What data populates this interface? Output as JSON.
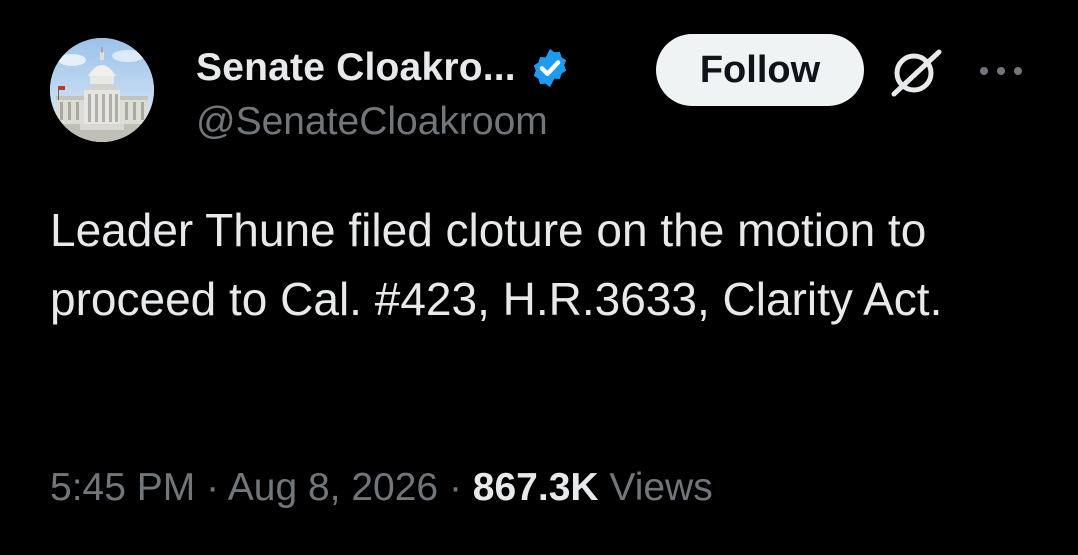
{
  "author": {
    "display_name": "Senate Cloakro...",
    "handle": "@SenateCloakroom",
    "verified": true
  },
  "actions": {
    "follow_label": "Follow",
    "grok_icon": "grok-icon",
    "more_icon": "more-icon"
  },
  "tweet": {
    "text": "Leader Thune filed cloture on the motion to proceed to Cal. #423, H.R.3633, Clarity Act.",
    "time": "5:45 PM",
    "separator": " · ",
    "date": "Aug 8, 2026",
    "views_count": "867.3K",
    "views_label": " Views"
  },
  "colors": {
    "background": "#000000",
    "primary_text": "#e7e9ea",
    "secondary_text": "#71767b",
    "verified_badge": "#1d9bf0",
    "follow_button_bg": "#eff3f4"
  }
}
